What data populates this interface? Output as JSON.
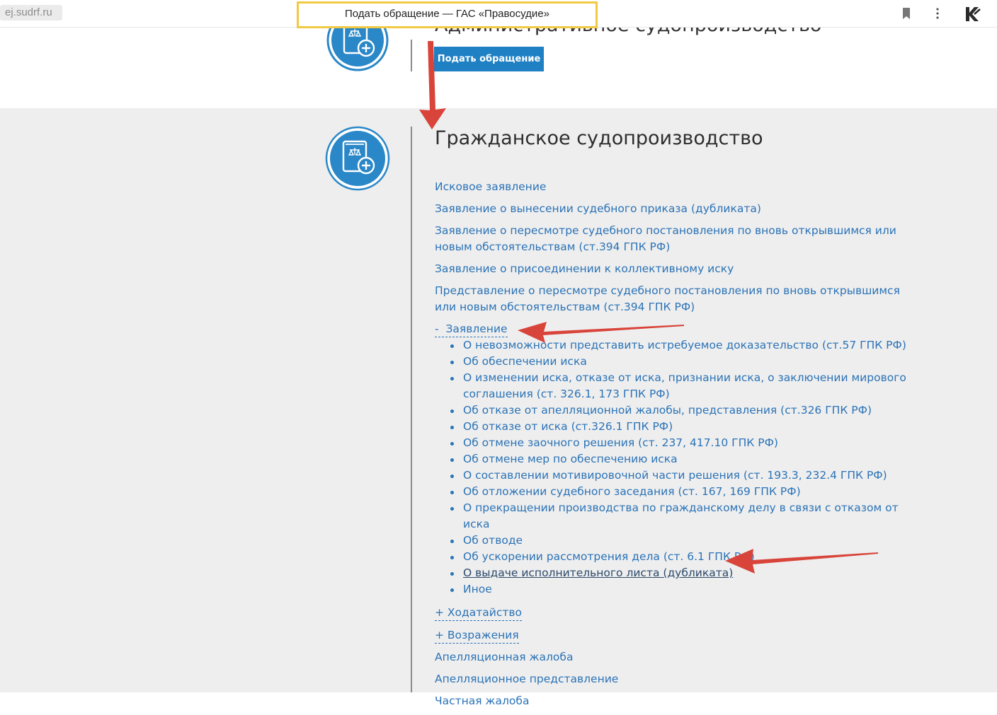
{
  "browser": {
    "url": "ej.sudrf.ru",
    "tab_title": "Подать обращение — ГАС «Правосудие»",
    "icons": [
      "bookmark-icon",
      "menu-icon",
      "extension-icon"
    ]
  },
  "top_section": {
    "peek_title": "Административное судопроизводство",
    "submit_button": "Подать обращение"
  },
  "civil": {
    "title": "Гражданское судопроизводство",
    "links": [
      "Исковое заявление",
      "Заявление о вынесении судебного приказа (дубликата)",
      "Заявление о пересмотре судебного постановления по вновь открывшимся или новым обстоятельствам (ст.394 ГПК РФ)",
      "Заявление о присоединении к коллективному иску",
      "Представление о пересмотре судебного постановления по вновь открывшимся или новым обстоятельствам (ст.394 ГПК РФ)"
    ],
    "statement_toggle": "-  Заявление",
    "statement_items": [
      "О невозможности представить истребуемое доказательство (ст.57 ГПК РФ)",
      "Об обеспечении иска",
      "О изменении иска, отказе от иска, признании иска, о заключении мирового соглашения (ст. 326.1, 173 ГПК РФ)",
      "Об отказе от апелляционной жалобы, представления (ст.326 ГПК РФ)",
      "Об отказе от иска (ст.326.1 ГПК РФ)",
      "Об отмене заочного решения (ст. 237, 417.10 ГПК РФ)",
      "Об отмене мер по обеспечению иска",
      "О составлении мотивировочной части решения (ст. 193.3, 232.4 ГПК РФ)",
      "Об отложении судебного заседания (ст. 167, 169 ГПК РФ)",
      "О прекращении производства по гражданскому делу в связи с отказом от иска",
      "Об отводе",
      "Об ускорении рассмотрения дела (ст. 6.1 ГПК РФ)",
      "О выдаче исполнительного листа (дубликата)",
      "Иное"
    ],
    "petition_toggle": "+ Ходатайство",
    "objections_toggle": "+ Возражения",
    "bottom_links": [
      "Апелляционная жалоба",
      "Апелляционное представление",
      "Частная жалоба"
    ]
  },
  "colors": {
    "link": "#2b73b7",
    "button": "#1f80c4",
    "circle": "#2a87c8",
    "annotation_arrow": "#d9443a",
    "highlight_box": "#f1c943"
  }
}
